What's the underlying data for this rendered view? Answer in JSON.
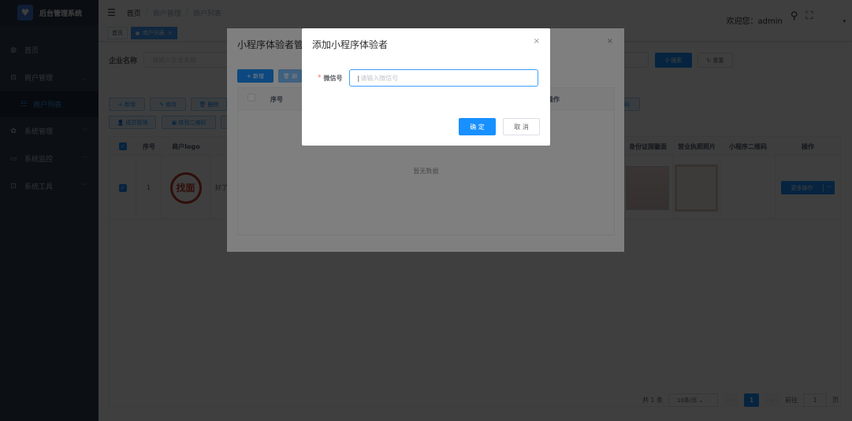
{
  "app": {
    "title": "后台管理系统"
  },
  "sidebar": {
    "items": [
      {
        "label": "首页",
        "icon": "dashboard-icon"
      },
      {
        "label": "商户管理",
        "icon": "shop-icon",
        "expanded": true,
        "children": [
          {
            "label": "商户列表",
            "icon": "list-icon",
            "active": true
          }
        ]
      },
      {
        "label": "系统管理",
        "icon": "gear-icon"
      },
      {
        "label": "系统监控",
        "icon": "monitor-icon"
      },
      {
        "label": "系统工具",
        "icon": "toolbox-icon"
      }
    ]
  },
  "navbar": {
    "breadcrumb": [
      "首页",
      "商户管理",
      "商户列表"
    ],
    "welcome": "欢迎您：admin"
  },
  "tags": [
    {
      "label": "首页",
      "active": false
    },
    {
      "label": "商户列表",
      "active": true
    }
  ],
  "search": {
    "label": "企业名称",
    "placeholder": "请输入企业名称",
    "search_btn": "搜索",
    "reset_btn": "重置"
  },
  "toolbar": {
    "add": "新增",
    "edit": "修改",
    "delete": "删除",
    "member": "成员管理",
    "qrcode": "体验二维码",
    "qrcode2": "码"
  },
  "table": {
    "headers": [
      "序号",
      "商户logo",
      "身份证国徽面",
      "营业执照照片",
      "小程序二维码",
      "操作"
    ],
    "rows": [
      {
        "index": "1",
        "logo_text": "找面",
        "name_partial": "好了",
        "more": "更多操作"
      }
    ]
  },
  "pagination": {
    "total": "共 1 条",
    "page_size": "10条/页",
    "current": "1",
    "goto_label": "前往",
    "goto_value": "1",
    "page_suffix": "页"
  },
  "dialog_members": {
    "title": "小程序体验者管理",
    "add": "新增",
    "delete_partial": "删",
    "headers": [
      "序号",
      "操作"
    ],
    "empty": "暂无数据"
  },
  "dialog_add": {
    "title": "添加小程序体验者",
    "field_label": "微信号",
    "placeholder": "请输入微信号",
    "ok": "确 定",
    "cancel": "取 消"
  },
  "colors": {
    "primary": "#1890ff",
    "sidebar": "#304156",
    "danger": "#f56c6c"
  }
}
